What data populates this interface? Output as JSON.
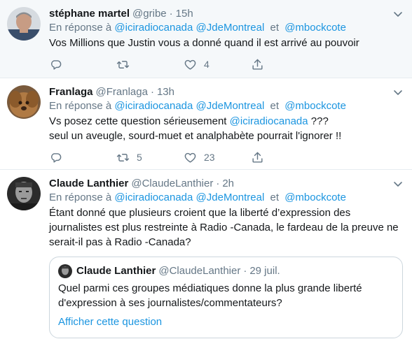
{
  "tweets": [
    {
      "name": "stéphane martel",
      "handle": "@gribe",
      "dot": "·",
      "time": "15h",
      "reply_prefix": "En réponse à",
      "mentions": [
        "@iciradiocanada",
        "@JdeMontreal",
        "@mbockcote"
      ],
      "and": "et",
      "text": "Vos Millions que Justin vous a donné quand il est arrivé au pouvoir",
      "reply_count": "",
      "retweet_count": "",
      "like_count": "4"
    },
    {
      "name": "Franlaga",
      "handle": "@Franlaga",
      "dot": "·",
      "time": "13h",
      "reply_prefix": "En réponse à",
      "mentions": [
        "@iciradiocanada",
        "@JdeMontreal",
        "@mbockcote"
      ],
      "and": "et",
      "text_before": "Vs posez cette question sérieusement ",
      "text_mention": "@iciradiocanada",
      "text_after": " ???",
      "text_line2": "seul un aveugle, sourd-muet et analphabète pourrait l'ignorer !!",
      "retweet_count": "5",
      "like_count": "23"
    },
    {
      "name": "Claude Lanthier",
      "handle": "@ClaudeLanthier",
      "dot": "·",
      "time": "2h",
      "reply_prefix": "En réponse à",
      "mentions": [
        "@iciradiocanada",
        "@JdeMontreal",
        "@mbockcote"
      ],
      "and": "et",
      "text": "Étant donné que plusieurs croient que la liberté d’expression des journalistes est plus restreinte à Radio -Canada, le fardeau de la preuve ne serait-il pas à Radio -Canada?",
      "quote": {
        "name": "Claude Lanthier",
        "handle": "@ClaudeLanthier",
        "dot": "·",
        "date": "29 juil.",
        "text": "Quel parmi ces groupes médiatiques donne la plus grande liberté d'expression à ses journalistes/commentateurs?",
        "link": "Afficher cette question"
      }
    }
  ],
  "colors": {
    "link": "#1b95e0",
    "secondary": "#657786",
    "border": "#e6ecf0",
    "highlight_bg": "#f5f8fa"
  },
  "icons": [
    "reply-icon",
    "retweet-icon",
    "like-icon",
    "share-icon",
    "caret-down-icon"
  ]
}
